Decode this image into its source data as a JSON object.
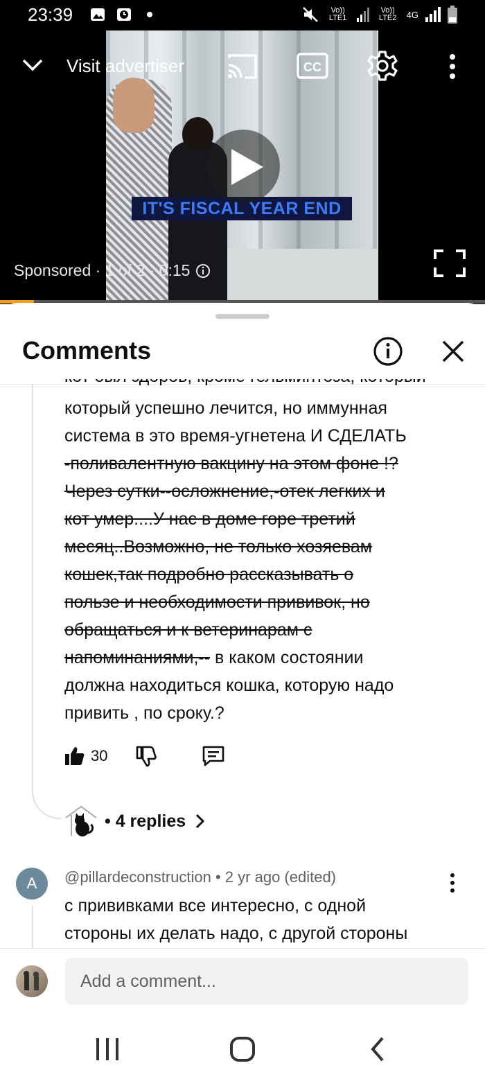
{
  "status_bar": {
    "time": "23:39",
    "sim1": "Vo)) LTE1",
    "sim2": "Vo)) LTE2",
    "network": "4G"
  },
  "video": {
    "visit_label": "Visit advertiser",
    "caption": "IT'S FISCAL YEAR END",
    "sponsored_text": "Sponsored · 1 of 2 · 0:15",
    "progress_fraction": 0.07
  },
  "comments_sheet": {
    "title": "Comments",
    "comment1": {
      "cut_line": "кот был здоров, кроме гельминтоза, который",
      "line1": "который успешно лечится, но иммунная",
      "line2": "система в это время-угнетена И СДЕЛАТЬ",
      "struck": [
        "-поливалентную вакцину на этом фоне !?",
        "Через сутки--осложнение,-отек легких и",
        "кот умер....У нас в доме горе третий",
        "месяц..Возможно, не только хозяевам",
        "кошек,так подробно рассказывать о",
        "пользе и необходимости прививок, но",
        "обращаться и к ветеринарам с",
        "напоминаниями,--"
      ],
      "tail_first": " в каком состоянии",
      "tail_lines": [
        "должна находиться кошка, которую надо",
        "привить , по сроку.?"
      ],
      "likes": "30",
      "replies_label": "• 4 replies"
    },
    "comment2": {
      "avatar_letter": "A",
      "meta": "@pillardeconstruction • 2 yr ago (edited)",
      "lines": [
        "с прививками все интересно, с одной",
        "стороны их делать надо, с другой стороны"
      ]
    },
    "add_comment_placeholder": "Add a comment..."
  }
}
